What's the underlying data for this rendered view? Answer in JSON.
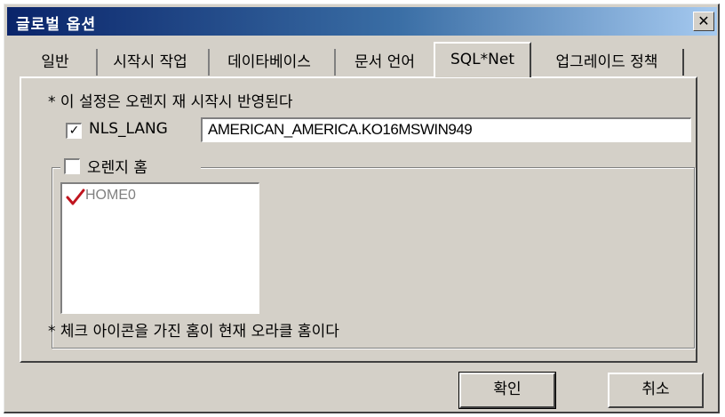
{
  "window": {
    "title": "글로벌 옵션",
    "close_glyph": "✕"
  },
  "tabs": [
    {
      "label": "일반"
    },
    {
      "label": "시작시 작업"
    },
    {
      "label": "데이타베이스"
    },
    {
      "label": "문서 언어"
    },
    {
      "label": "SQL*Net",
      "active": true
    },
    {
      "label": "업그레이드 정책"
    }
  ],
  "panel": {
    "restart_note": "* 이 설정은 오렌지 재 시작시 반영된다",
    "nls_lang": {
      "label": "NLS_LANG",
      "checked": true,
      "value": "AMERICAN_AMERICA.KO16MSWIN949"
    },
    "orange_home": {
      "label": "오렌지 홈",
      "checked": false,
      "items": [
        {
          "name": "HOME0",
          "icon": "red-check-icon"
        }
      ]
    },
    "check_icon_note": "* 체크 아이콘을 가진 홈이 현재 오라클 홈이다"
  },
  "buttons": {
    "ok": "확인",
    "cancel": "취소"
  },
  "colors": {
    "title_start": "#0a246a",
    "title_end": "#a6caf0",
    "face": "#d4d0c8",
    "check_red": "#c0141e"
  }
}
